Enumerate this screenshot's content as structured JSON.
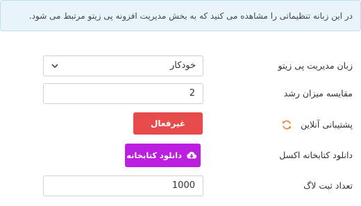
{
  "notice": {
    "text": "در این زبانه تنظیماتی را مشاهده می کنید که به بخش مدیریت افزونه پی زیتو مرتبط می شود."
  },
  "settings": {
    "admin_language": {
      "label": "زبان مدیریت پی زیتو",
      "value": "خودکار"
    },
    "growth_compare": {
      "label": "مقایسه میزان رشد",
      "value": "2"
    },
    "online_support": {
      "label": "پشتیبانی آنلاین",
      "button": "غیرفعال",
      "icon": "refresh-icon"
    },
    "excel_library": {
      "label": "دانلود کتابخانه اکسل",
      "button": "دانلود کتابخانه",
      "icon": "cloud-download-icon"
    },
    "log_count": {
      "label": "تعداد ثبت لاگ",
      "value": "1000"
    }
  },
  "colors": {
    "notice_bg": "#e8f4fa",
    "danger": "#e74c4c",
    "purple": "#bb1fe0",
    "refresh_orange": "#f08a3c"
  }
}
